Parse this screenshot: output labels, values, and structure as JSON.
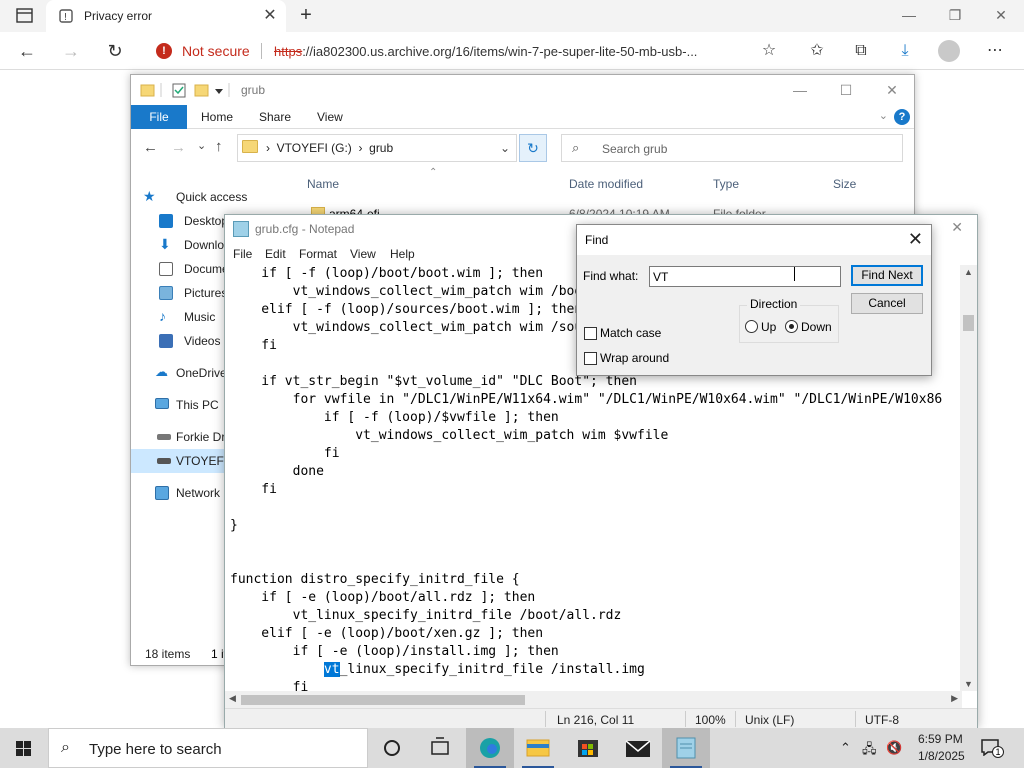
{
  "browser": {
    "tab_title": "Privacy error",
    "security_label": "Not secure",
    "url_scheme": "https",
    "url_rest": "://ia802300.us.archive.org/16/items/win-7-pe-super-lite-50-mb-usb-..."
  },
  "explorer": {
    "title": "grub",
    "ribbon_tabs": [
      "File",
      "Home",
      "Share",
      "View"
    ],
    "path_drive": "VTOYEFI (G:)",
    "path_folder": "grub",
    "search_placeholder": "Search grub",
    "columns": [
      "Name",
      "Date modified",
      "Type",
      "Size"
    ],
    "first_row": {
      "name": "arm64-efi",
      "date": "6/8/2024 10:19 AM",
      "type": "File folder"
    },
    "nav_items": [
      "Quick access",
      "Desktop",
      "Downlo",
      "Docume",
      "Pictures",
      "Music",
      "Videos",
      "OneDrive",
      "This PC",
      "Forkie Dri",
      "VTOYEFI (",
      "Network"
    ],
    "status_items": "18 items",
    "status_selected": "1 it"
  },
  "notepad": {
    "title": "grub.cfg - Notepad",
    "menu": [
      "File",
      "Edit",
      "Format",
      "View",
      "Help"
    ],
    "lines_before_hl": [
      "    if [ -f (loop)/boot/boot.wim ]; then",
      "        vt_windows_collect_wim_patch wim /boot/boot.wim",
      "    elif [ -f (loop)/sources/boot.wim ]; then",
      "        vt_windows_collect_wim_patch wim /sources/boot.wim",
      "    fi",
      "",
      "    if vt_str_begin \"$vt_volume_id\" \"DLC Boot\"; then",
      "        for vwfile in \"/DLC1/WinPE/W11x64.wim\" \"/DLC1/WinPE/W10x64.wim\" \"/DLC1/WinPE/W10x86",
      "            if [ -f (loop)/$vwfile ]; then",
      "                vt_windows_collect_wim_patch wim $vwfile",
      "            fi",
      "        done",
      "    fi",
      "",
      "}",
      "",
      "",
      "function distro_specify_initrd_file {",
      "    if [ -e (loop)/boot/all.rdz ]; then",
      "        vt_linux_specify_initrd_file /boot/all.rdz",
      "    elif [ -e (loop)/boot/xen.gz ]; then",
      "        if [ -e (loop)/install.img ]; then"
    ],
    "hl_line_indent": "            ",
    "hl_match": "vt",
    "hl_line_rest": "_linux_specify_initrd_file /install.img",
    "last_line": "        fi",
    "status_position": "Ln 216, Col 11",
    "status_zoom": "100%",
    "status_eol": "Unix (LF)",
    "status_encoding": "UTF-8"
  },
  "find": {
    "title": "Find",
    "label": "Find what:",
    "value": "VT",
    "find_next": "Find Next",
    "cancel": "Cancel",
    "direction_label": "Direction",
    "up_label": "Up",
    "down_label": "Down",
    "match_case": "Match case",
    "wrap_around": "Wrap around"
  },
  "taskbar": {
    "search_placeholder": "Type here to search",
    "time": "6:59 PM",
    "date": "1/8/2025",
    "notification_count": "1"
  },
  "colors": {
    "accent": "#0078d7",
    "explorer_blue": "#1979ca",
    "danger": "#c42b1c"
  }
}
